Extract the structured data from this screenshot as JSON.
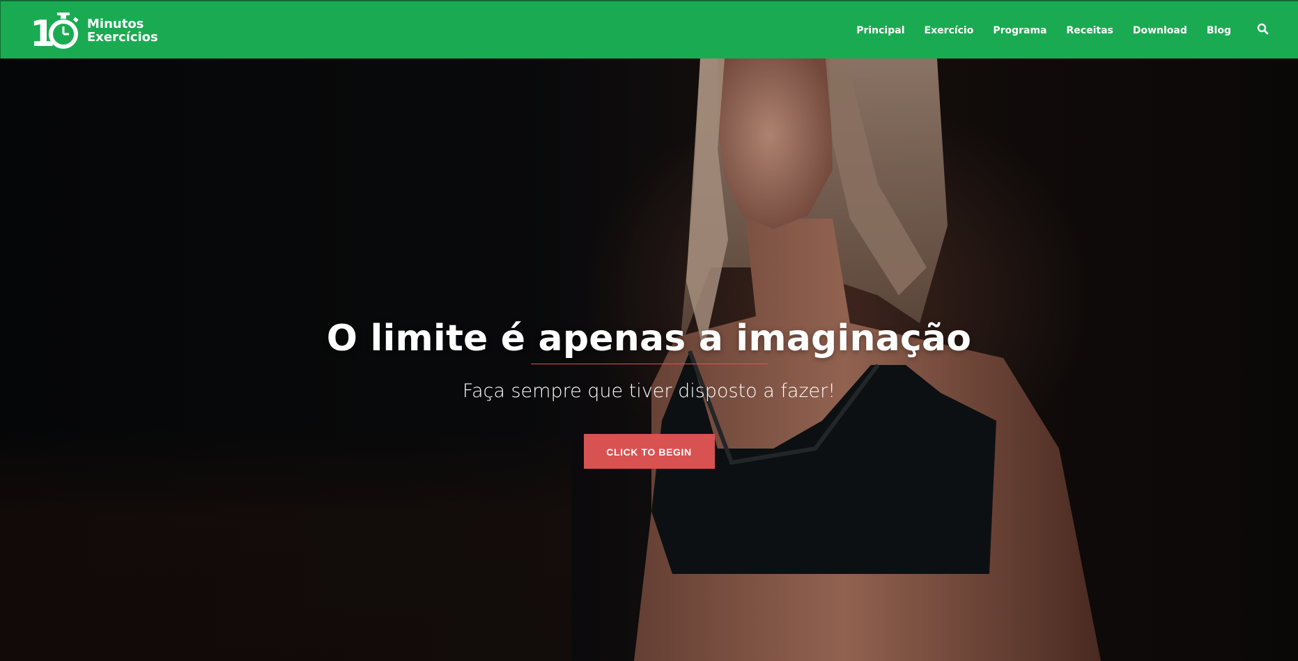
{
  "header": {
    "logo": {
      "number": "10",
      "line1": "Minutos",
      "line2": "Exercícios"
    },
    "nav": [
      {
        "label": "Principal"
      },
      {
        "label": "Exercício"
      },
      {
        "label": "Programa"
      },
      {
        "label": "Receitas"
      },
      {
        "label": "Download"
      },
      {
        "label": "Blog"
      }
    ],
    "search_icon": "search-icon"
  },
  "hero": {
    "title": "O limite é apenas a imaginação",
    "subtitle": "Faça sempre que tiver disposto a fazer!",
    "cta_label": "CLICK TO BEGIN"
  },
  "colors": {
    "header_bg": "#1aab52",
    "accent": "#d95252",
    "text": "#ffffff"
  }
}
